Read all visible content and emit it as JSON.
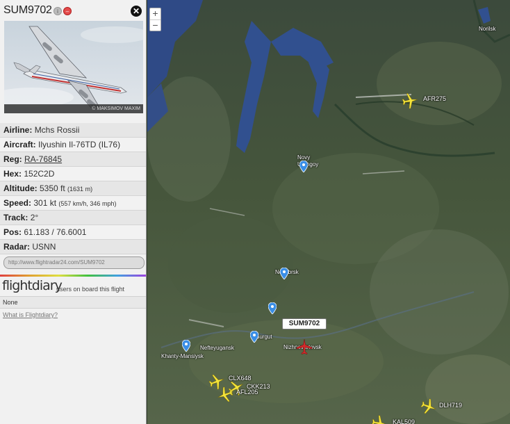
{
  "panel": {
    "callsign": "SUM9702",
    "photo_credit": "© MAKSIMOV MAXIM",
    "fields": [
      {
        "label": "Airline:",
        "value": "Mchs Rossii"
      },
      {
        "label": "Aircraft:",
        "value": "Ilyushin Il-76TD (IL76)"
      },
      {
        "label": "Reg:",
        "value": "RA-76845"
      },
      {
        "label": "Hex:",
        "value": "152C2D"
      },
      {
        "label": "Altitude:",
        "value": "5350 ft",
        "sub": "(1631 m)"
      },
      {
        "label": "Speed:",
        "value": "301 kt",
        "sub": "(557 km/h, 346 mph)"
      },
      {
        "label": "Track:",
        "value": "2°"
      },
      {
        "label": "Pos:",
        "value": "61.183 / 76.6001"
      },
      {
        "label": "Radar:",
        "value": "USNN"
      }
    ],
    "url": "http://www.flightradar24.com/SUM9702",
    "flightdiary": {
      "logo": "flightdiary",
      "subtitle": "users on board this flight",
      "none_text": "None",
      "link": "What is Flightdiary?"
    }
  },
  "map": {
    "zoom_in": "+",
    "zoom_out": "−",
    "selected_tag": "SUM9702",
    "places": [
      "Norilsk",
      "Novy Urengoy",
      "Noyabrsk",
      "Nefteyugansk",
      "Surgut",
      "Nizhnevartovsk",
      "Khanty-Mansiysk"
    ],
    "flights": [
      "AFR275",
      "CLX648",
      "CKK213",
      "AFL205",
      "DLH719",
      "KAL509"
    ],
    "colors": {
      "plane": "#f4e43a",
      "selected_plane": "#d42a2a",
      "pin": "#3a8ee6"
    }
  }
}
